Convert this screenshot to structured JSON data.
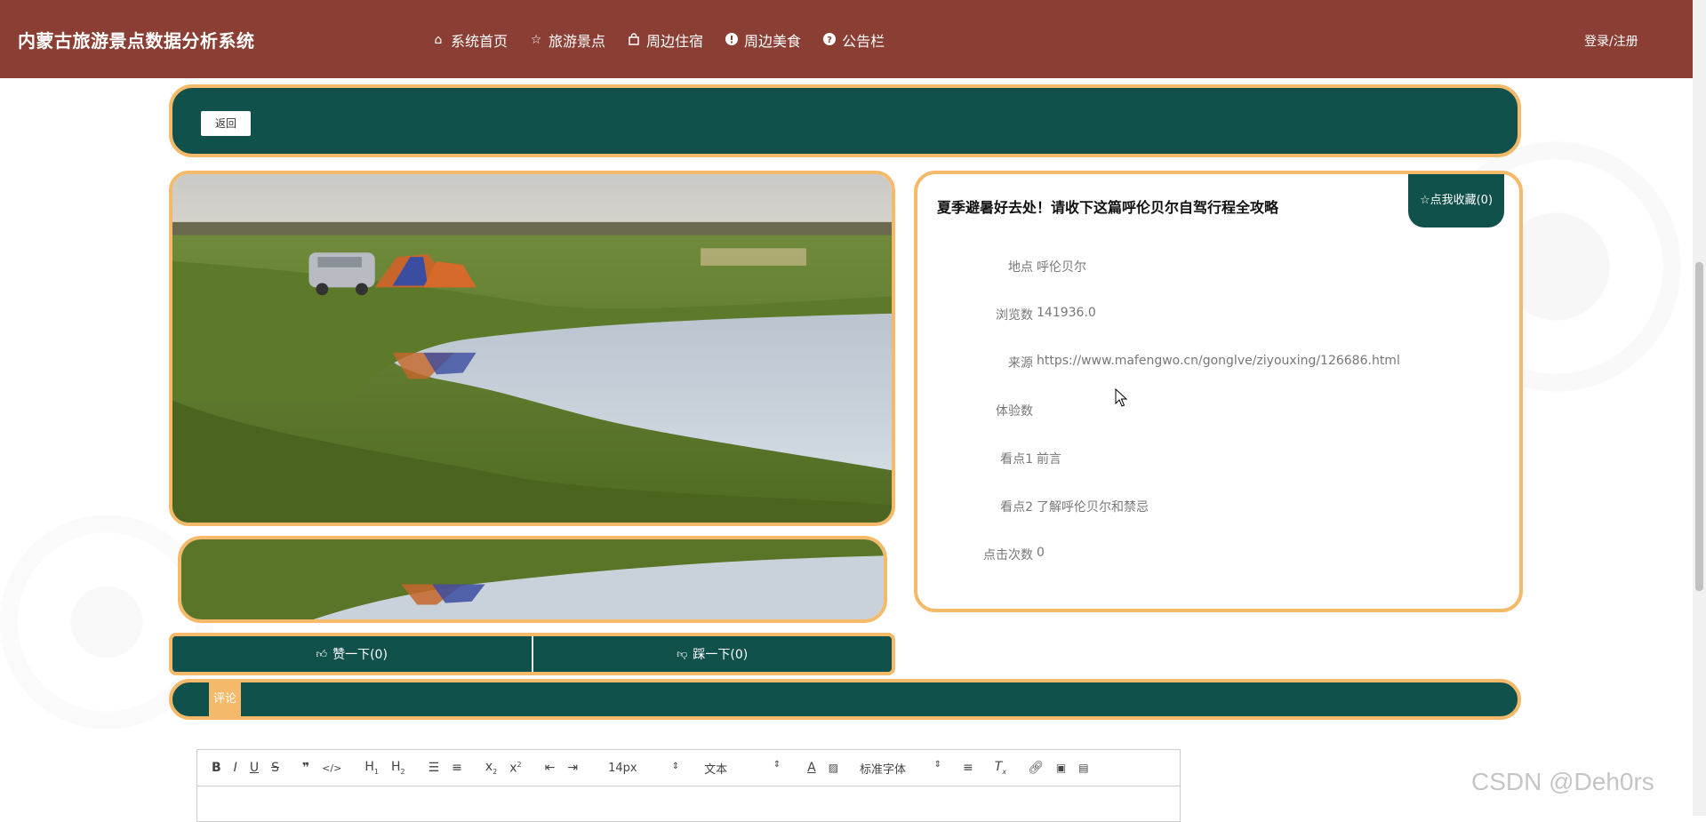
{
  "header": {
    "brand": "内蒙古旅游景点数据分析系统",
    "nav": [
      {
        "label": "系统首页",
        "icon": "home-icon"
      },
      {
        "label": "旅游景点",
        "icon": "star-icon"
      },
      {
        "label": "周边住宿",
        "icon": "bag-icon"
      },
      {
        "label": "周边美食",
        "icon": "alert-icon"
      },
      {
        "label": "公告栏",
        "icon": "help-icon"
      }
    ],
    "login": "登录/注册"
  },
  "back_label": "返回",
  "detail": {
    "title": "夏季避暑好去处！请收下这篇呼伦贝尔自驾行程全攻略",
    "favorite_label": "☆点我收藏(0)",
    "fields": [
      {
        "label": "地点",
        "value": "呼伦贝尔"
      },
      {
        "label": "浏览数",
        "value": "141936.0"
      },
      {
        "label": "来源",
        "value": "https://www.mafengwo.cn/gonglve/ziyouxing/126686.html"
      },
      {
        "label": "体验数",
        "value": ""
      },
      {
        "label": "看点1",
        "value": "前言"
      },
      {
        "label": "看点2",
        "value": "了解呼伦贝尔和禁忌"
      },
      {
        "label": "点击次数",
        "value": "0"
      }
    ]
  },
  "votes": {
    "like_label": "赞一下(0)",
    "dislike_label": "踩一下(0)"
  },
  "comment_tab": "评论",
  "editor": {
    "font_size": "14px",
    "block_type": "文本",
    "font_family": "标准字体"
  },
  "watermark": "CSDN @Deh0rs",
  "colors": {
    "header_bg": "#8b3e33",
    "accent_green": "#11514b",
    "border_orange": "#f5b96a"
  }
}
